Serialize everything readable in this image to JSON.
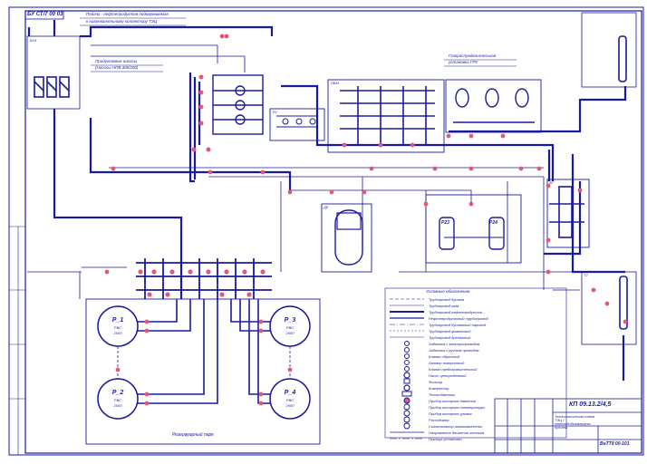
{
  "stamp": {
    "top_code": "БУ СТ/7 00 03",
    "title_code": "КП 09.13.2/4,5",
    "title_code_small": "ВнТТ9 00-101",
    "description": "Технологическая схема ТЭЦ / нефтедобывающего бутана"
  },
  "notes": {
    "top_note": "Подача - нефтепродуктов подогреваемая",
    "top_note_2": "к нагревательному коллектору ТЭЦ",
    "product_line_note": "Продуктовые насосы",
    "product_line_note_2": "(Насосы НПВ 300/200)",
    "right_note": "Газораспределительная",
    "right_note_2": "установка ГРУ"
  },
  "tanks": [
    {
      "code": "Р_1",
      "line1": "РВС",
      "line2": "2000"
    },
    {
      "code": "Р_2",
      "line1": "РВС",
      "line2": "2000"
    },
    {
      "code": "Р_3",
      "line1": "РВС",
      "line2": "2000"
    },
    {
      "code": "Р_4",
      "line1": "РВС",
      "line2": "2000"
    }
  ],
  "tank_farm_label": "Резервуарный парк",
  "equipment": {
    "box1": "БН1",
    "box2": "ТН",
    "box3": "ПБМ",
    "box4": "ФГ",
    "box5": "ДЕ",
    "box6": "Т2",
    "p23": "Р23",
    "p24": "Р24"
  },
  "legend_title": "Условные обозначения",
  "legend": [
    "Трубопровод бутана",
    "Трубопровод газа",
    "Трубопровод нефтепродуктов",
    "Нефтепродуктовый трубопровод",
    "Трубопровод бутановый паровой",
    "Трубопровод факельный",
    "Трубопровод дренажный",
    "Задвижка с электроприводом",
    "Задвижка с ручным приводом",
    "Клапан обратный",
    "Затвор поворотный",
    "Клапан предохранительный",
    "Насос центробежный",
    "Фильтр",
    "Компрессор",
    "Теплообменник",
    "Прибор контроля давления",
    "Прибор контроля температуры",
    "Прибор контроля уровня",
    "Расходомер",
    "Сигнализатор загазованности",
    "Направление движения потоков",
    "Граница установки"
  ],
  "colors": {
    "line": "#1a1aa0",
    "accent": "#e05a78",
    "thin": "#1a1aa0"
  }
}
